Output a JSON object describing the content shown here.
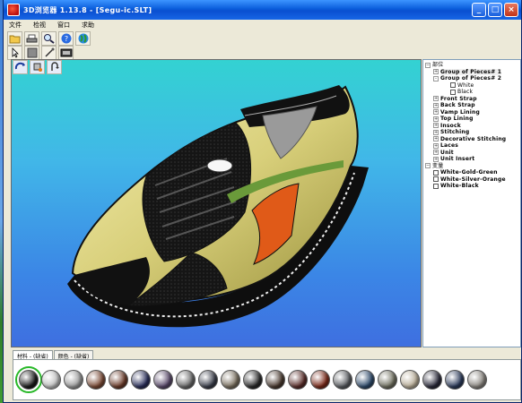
{
  "window": {
    "title": "3D浏览器  1.13.8  - [Segu-ic.SLT]",
    "controls": {
      "minimize": "_",
      "maximize": "□",
      "close": "×"
    }
  },
  "menu": [
    "文件",
    "检视",
    "窗口",
    "求助"
  ],
  "toolbar": {
    "row1_icons": [
      "open-folder-icon",
      "print-icon",
      "zoom-icon",
      "help-icon",
      "globe-icon"
    ],
    "row2_icons": [
      "pointer-icon",
      "texture-square-icon",
      "eyedropper-icon",
      "material-icon"
    ],
    "row3_icons": [
      "rotate-icon",
      "pan-icon",
      "move-icon"
    ]
  },
  "tree": {
    "root": "部位",
    "items": [
      {
        "label": "Group of Pieces# 1",
        "level": 1,
        "expander": "+"
      },
      {
        "label": "Group of Pieces# 2",
        "level": 1,
        "expander": "-"
      },
      {
        "label": "White",
        "level": 3,
        "expander": ""
      },
      {
        "label": "Black",
        "level": 3,
        "expander": ""
      },
      {
        "label": "Front Strap",
        "level": 1,
        "expander": "+"
      },
      {
        "label": "Back Strap",
        "level": 1,
        "expander": "+"
      },
      {
        "label": "Vamp Lining",
        "level": 1,
        "expander": "+"
      },
      {
        "label": "Top Lining",
        "level": 1,
        "expander": "+"
      },
      {
        "label": "Insock",
        "level": 1,
        "expander": "+"
      },
      {
        "label": "Stitching",
        "level": 1,
        "expander": "+"
      },
      {
        "label": "Decorative Stitching",
        "level": 1,
        "expander": "+"
      },
      {
        "label": "Laces",
        "level": 1,
        "expander": "+"
      },
      {
        "label": "Unit",
        "level": 1,
        "expander": "+"
      },
      {
        "label": "Unit Insert",
        "level": 1,
        "expander": "+"
      }
    ],
    "variants_root": "变量",
    "variants": [
      "White-Gold-Green",
      "White-Silver-Orange",
      "White-Black"
    ]
  },
  "tabs": [
    "材料 - (缺省)",
    "颜色 - (缺省)"
  ],
  "swatches": [
    "#1a1a1a",
    "#bfbfbf",
    "#9a9a9a",
    "#7a4a36",
    "#6a3b2a",
    "#2a2f5a",
    "#5a4a6a",
    "#6a6a6a",
    "#3a3e4a",
    "#7a7060",
    "#2a2a2a",
    "#4a3a30",
    "#5a2e2a",
    "#7a2a1a",
    "#595c60",
    "#2e4a6a",
    "#707060",
    "#b8ad98",
    "#2a2a3a",
    "#2b3a5a",
    "#8a8680"
  ],
  "colors": {
    "viewport_top": "#33d2d2",
    "viewport_bottom": "#3e6fe0",
    "selection_outline": "#28b828"
  }
}
